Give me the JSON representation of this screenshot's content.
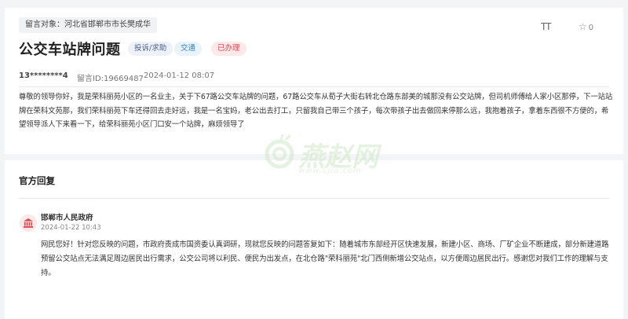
{
  "message": {
    "recipient": "留言对象：河北省邯郸市市长樊成华",
    "font_tool_label": "TT",
    "like_count": "0",
    "title": "公交车站牌问题",
    "tags": [
      "投诉/求助",
      "交通",
      "已办理"
    ],
    "user": "13********4",
    "id_text": "留言ID:19669487",
    "date": "2024-01-12 08:07",
    "body": "尊敬的领导你好，我是荣科丽苑小区的一名业主，关于下67路公交车站牌的问题，67路公交车从荀子大街右转北仓路东部美的城那没有公交站牌，但司机师傅给人家小区那停，下一站站牌在荣科文苑那，我们荣科丽苑下车还得回去走好远，我是一名宝妈，老公出去打工，只留我自己带三个孩子，每次带孩子出去做回来停那么远，我抱着孩子，拿着东西很不方便的，希望领导派人下来看一下，给荣科丽苑小区门口安一个站牌，麻烦领导了"
  },
  "reply": {
    "section_title": "官方回复",
    "org_name": "邯郸市人民政府",
    "date": "2024-01-22 10:43",
    "body": "网民您好！针对您反映的问题，市政府责成市国资委认真调研，现就您反映的问题答复如下：随着城市东部经开区快速发展，新建小区、商场、厂矿企业不断建成，部分新建道路预留公交站点无法满足周边居民出行需求，公交公司将以利民、便民为出发点，在北仓路\"荣科丽苑\"北门西侧新增公交站点，以方便周边居民出行。感谢您对我们工作的理解与支持。"
  },
  "watermark": {
    "main": "燕赵网",
    "url": "www.Ljia.com"
  },
  "colors": {
    "tag_complaint": "#49608a",
    "tag_traffic": "#3d86c6",
    "tag_done": "#e0434f"
  }
}
